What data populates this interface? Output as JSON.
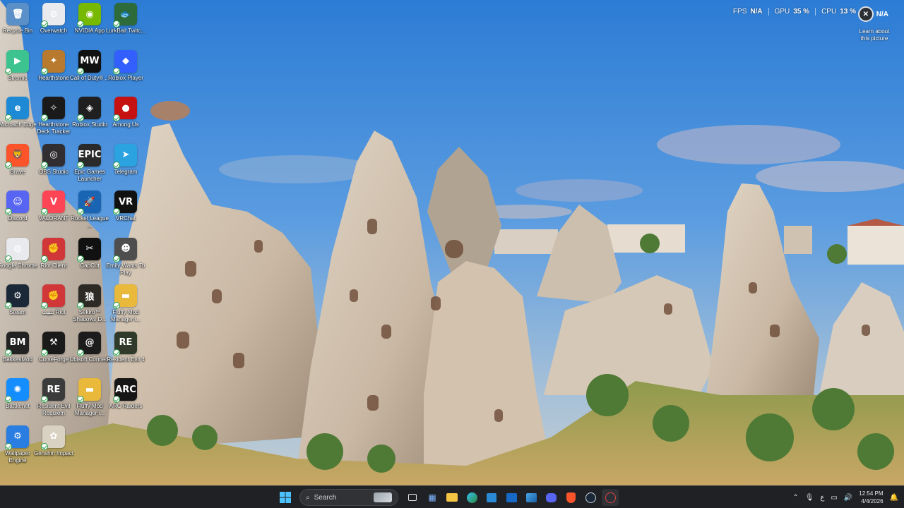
{
  "desktop": {
    "icons": [
      {
        "label": "Recycle Bin",
        "icon": "recycle-bin-icon",
        "color": "#5a8fc7",
        "glyph": "🗑"
      },
      {
        "label": "Overwatch",
        "icon": "overwatch-icon",
        "color": "#e8eaed",
        "glyph": "⊙"
      },
      {
        "label": "NVIDIA App",
        "icon": "nvidia-icon",
        "color": "#76b900",
        "glyph": "◉"
      },
      {
        "label": "LurkBait Twitc...",
        "icon": "lurkbait-icon",
        "color": "#2e6b3a",
        "glyph": "🐟"
      },
      {
        "label": "Stremio",
        "icon": "stremio-icon",
        "color": "#3cc38f",
        "glyph": "▶"
      },
      {
        "label": "Hearthstone",
        "icon": "hearthstone-icon",
        "color": "#b77a2e",
        "glyph": "✦"
      },
      {
        "label": "Call of Duty® ...",
        "icon": "call-of-duty-icon",
        "color": "#111111",
        "glyph": "MW"
      },
      {
        "label": "Roblox Player",
        "icon": "roblox-player-icon",
        "color": "#335fff",
        "glyph": "◆"
      },
      {
        "label": "Microsoft Edge",
        "icon": "edge-icon",
        "color": "#1e8ad6",
        "glyph": "e"
      },
      {
        "label": "Hearthstone Deck Tracker",
        "icon": "deck-tracker-icon",
        "color": "#1a1a1a",
        "glyph": "✧"
      },
      {
        "label": "Roblox Studio",
        "icon": "roblox-studio-icon",
        "color": "#1f1f1f",
        "glyph": "◈"
      },
      {
        "label": "Among Us",
        "icon": "among-us-icon",
        "color": "#c51111",
        "glyph": "●"
      },
      {
        "label": "Brave",
        "icon": "brave-icon",
        "color": "#fb542b",
        "glyph": "🦁"
      },
      {
        "label": "OBS Studio",
        "icon": "obs-icon",
        "color": "#302e31",
        "glyph": "◎"
      },
      {
        "label": "Epic Games Launcher",
        "icon": "epic-games-icon",
        "color": "#2a2a2a",
        "glyph": "EPIC"
      },
      {
        "label": "Telegram",
        "icon": "telegram-icon",
        "color": "#2aa3e0",
        "glyph": "➤"
      },
      {
        "label": "Discord",
        "icon": "discord-icon",
        "color": "#5865f2",
        "glyph": "☺"
      },
      {
        "label": "VALORANT",
        "icon": "valorant-icon",
        "color": "#fd4556",
        "glyph": "V"
      },
      {
        "label": "Rocket League ...",
        "icon": "rocket-league-icon",
        "color": "#1a64b4",
        "glyph": "🚀"
      },
      {
        "label": "VRChat",
        "icon": "vrchat-icon",
        "color": "#111111",
        "glyph": "VR"
      },
      {
        "label": "Google Chrome",
        "icon": "chrome-icon",
        "color": "#e8eaed",
        "glyph": "◍"
      },
      {
        "label": "Riot Client",
        "icon": "riot-client-icon",
        "color": "#d13639",
        "glyph": "✊"
      },
      {
        "label": "CapCut",
        "icon": "capcut-icon",
        "color": "#111111",
        "glyph": "✂"
      },
      {
        "label": "Emily Wants To Play",
        "icon": "emily-wants-to-play-icon",
        "color": "#4e4e4e",
        "glyph": "☻"
      },
      {
        "label": "Steam",
        "icon": "steam-icon",
        "color": "#1b2838",
        "glyph": "⚙"
      },
      {
        "label": "تثبيت Riot",
        "icon": "riot-install-icon",
        "color": "#d13639",
        "glyph": "✊"
      },
      {
        "label": "Sekiro™ Shadows D...",
        "icon": "sekiro-icon",
        "color": "#2d2a26",
        "glyph": "狼"
      },
      {
        "label": "Fluffy Mod Manager i...",
        "icon": "folder-icon",
        "color": "#e8b93a",
        "glyph": "▬"
      },
      {
        "label": "BakkesMod",
        "icon": "bakkesmod-icon",
        "color": "#222222",
        "glyph": "BM"
      },
      {
        "label": "CurseForge",
        "icon": "curseforge-icon",
        "color": "#1a1a1a",
        "glyph": "⚒"
      },
      {
        "label": "Ubisoft Connect",
        "icon": "ubisoft-icon",
        "color": "#1c1c1c",
        "glyph": "@"
      },
      {
        "label": "Resident Evil 4",
        "icon": "resident-evil-4-icon",
        "color": "#2f3a2a",
        "glyph": "RE"
      },
      {
        "label": "Battle.net",
        "icon": "battlenet-icon",
        "color": "#148eff",
        "glyph": "✺"
      },
      {
        "label": "Resident Evil Requiem",
        "icon": "resident-evil-requiem-icon",
        "color": "#3b3b3b",
        "glyph": "RE"
      },
      {
        "label": "Fluffy Mod Manager i...",
        "icon": "folder-icon",
        "color": "#e8b93a",
        "glyph": "▬"
      },
      {
        "label": "ARC Raiders",
        "icon": "arc-raiders-icon",
        "color": "#161616",
        "glyph": "ARC"
      },
      {
        "label": "Wallpaper Engine",
        "icon": "wallpaper-engine-icon",
        "color": "#2a7de1",
        "glyph": "⚙"
      },
      {
        "label": "Genshin Impact",
        "icon": "genshin-impact-icon",
        "color": "#d9d2c2",
        "glyph": "✿"
      }
    ]
  },
  "overlay": {
    "fps_label": "FPS",
    "fps_value": "N/A",
    "gpu_label": "GPU",
    "gpu_value": "35 %",
    "cpu_label": "CPU",
    "cpu_value": "13 %",
    "badge_value": "N/A",
    "learn_about": "Learn about this picture"
  },
  "taskbar": {
    "search_placeholder": "Search",
    "apps": [
      "widgets-icon",
      "file-explorer-icon",
      "edge-icon",
      "microsoft-store-icon",
      "outlook-icon",
      "photos-icon",
      "discord-icon",
      "brave-icon",
      "steam-icon",
      "overwolf-icon"
    ],
    "time": "12:54 PM",
    "date": "4/4/2026",
    "language": "ع"
  },
  "colors": {
    "taskbar_bg": "#1f2124",
    "sky_top": "#2e7fd6",
    "rock": "#d8ccbd"
  }
}
